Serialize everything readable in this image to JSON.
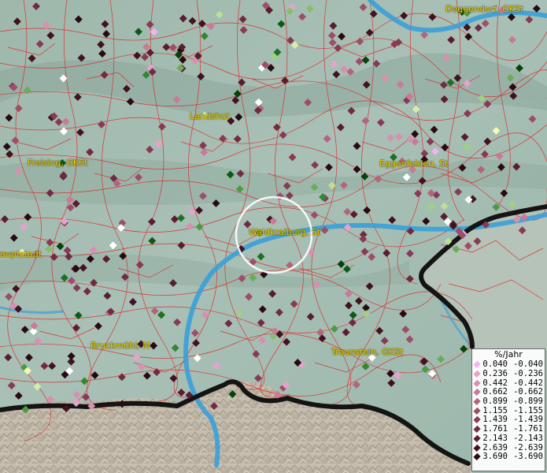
{
  "places": [
    {
      "id": "deggendorf",
      "label": "Deggendorf, GKSt"
    },
    {
      "id": "landshut",
      "label": "Landshut"
    },
    {
      "id": "freising",
      "label": "Freising, GKSt"
    },
    {
      "id": "eggenfelden",
      "label": "Eggenfelden, St"
    },
    {
      "id": "waldkraiburg",
      "label": "Waldkraiburg, St"
    },
    {
      "id": "hauptstadt",
      "label": "auptstadt"
    },
    {
      "id": "bruckmuehl",
      "label": "Bruckmühl, M"
    },
    {
      "id": "traunstein",
      "label": "Traunstein, GKSt"
    }
  ],
  "legend": {
    "title": "%/Jahr",
    "rows": [
      {
        "pos": "0.040",
        "neg": "-0.040",
        "pos_color": "#f5b2f0",
        "neg_color": "#f4f8b0"
      },
      {
        "pos": "0.236",
        "neg": "-0.236",
        "pos_color": "#e6a2cc",
        "neg_color": "#d6ecaa"
      },
      {
        "pos": "0.442",
        "neg": "-0.442",
        "pos_color": "#d88fb0",
        "neg_color": "#bddf96"
      },
      {
        "pos": "0.662",
        "neg": "-0.662",
        "pos_color": "#c87a98",
        "neg_color": "#a2cf82"
      },
      {
        "pos": "0.899",
        "neg": "-0.899",
        "pos_color": "#b4647e",
        "neg_color": "#86be6c"
      },
      {
        "pos": "1.155",
        "neg": "-1.155",
        "pos_color": "#9e4e68",
        "neg_color": "#6aac58"
      },
      {
        "pos": "1.439",
        "neg": "-1.439",
        "pos_color": "#883a54",
        "neg_color": "#4e9a44"
      },
      {
        "pos": "1.761",
        "neg": "-1.761",
        "pos_color": "#722a42",
        "neg_color": "#348632"
      },
      {
        "pos": "2.143",
        "neg": "-2.143",
        "pos_color": "#5a1c30",
        "neg_color": "#1e7022"
      },
      {
        "pos": "2.639",
        "neg": "-2.639",
        "pos_color": "#421220",
        "neg_color": "#0e5a14"
      },
      {
        "pos": "3.690",
        "neg": "-3.690",
        "pos_color": "#2a0a12",
        "neg_color": "#04420a"
      }
    ]
  },
  "colors": {
    "border_lines": "#e02020",
    "river": "#3aa0d8",
    "state_border": "#141414",
    "label_text": "#e8d200",
    "highlight_ring": "#ffffff"
  }
}
